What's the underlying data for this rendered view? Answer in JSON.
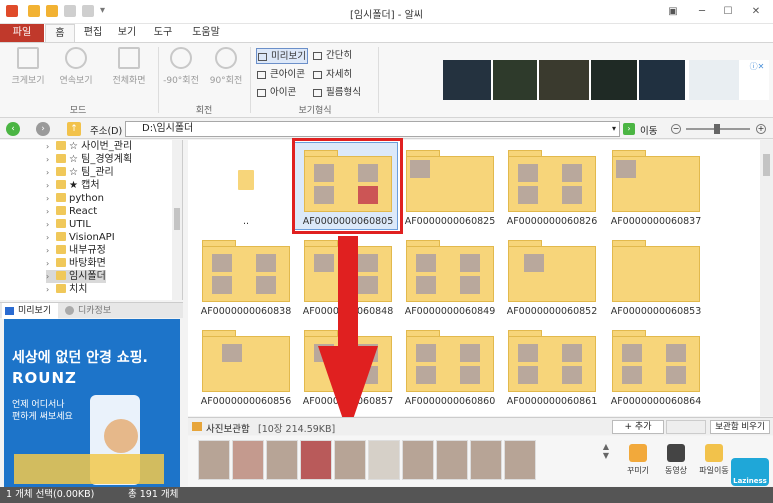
{
  "window": {
    "title": "[임시폴더] - 알씨"
  },
  "ribbon_tabs": [
    "파일",
    "홈",
    "편집",
    "보기",
    "도구",
    "도움말"
  ],
  "ribbon": {
    "buttons": [
      "크게보기",
      "연속보기",
      "전체화면",
      "-90°회전",
      "90°회전"
    ],
    "groups": [
      "모드",
      "회전",
      "보기형식"
    ],
    "view_options": [
      "미리보기",
      "간단히",
      "큰아이콘",
      "자세히",
      "아이콘",
      "필름형식"
    ]
  },
  "address": {
    "label": "주소(D)",
    "path": "D:\\임시폴더",
    "go": "이동"
  },
  "tree": [
    "☆ 사이번_관리",
    "☆ 팀_경영계획",
    "☆ 팀_관리",
    "★ 캡처",
    "python",
    "React",
    "UTIL",
    "VisionAPI",
    "내부규정",
    "바탕화면",
    "임시폴더",
    "치치"
  ],
  "preview_tabs": [
    "미리보기",
    "디카정보"
  ],
  "ad": {
    "line1": "세상에 없던 안경 쇼핑.",
    "brand": "ROUNZ",
    "sub1": "언제 어디서나",
    "sub2": "편하게 써보세요"
  },
  "tiles": [
    "..",
    "AF0000000060805",
    "AF0000000060825",
    "AF0000000060826",
    "AF0000000060837",
    "AF0000000060838",
    "AF0000000060848",
    "AF0000000060849",
    "AF0000000060852",
    "AF0000000060853",
    "AF0000000060856",
    "AF0000000060857",
    "AF0000000060860",
    "AF0000000060861",
    "AF0000000060864"
  ],
  "tray": {
    "label": "사진보관함",
    "info": "[10장 214.59KB]",
    "add": "+ 추가",
    "clear": "보관함 비우기",
    "tools": [
      "꾸미기",
      "동영상",
      "파일이동"
    ],
    "badge": "Laziness"
  },
  "status": {
    "selection": "1 개체 선택(0.00KB)",
    "total": "총 191 개체"
  },
  "colors": {
    "accent": "#c0392b",
    "annotation": "#e02020",
    "folder": "#f7d57a"
  }
}
